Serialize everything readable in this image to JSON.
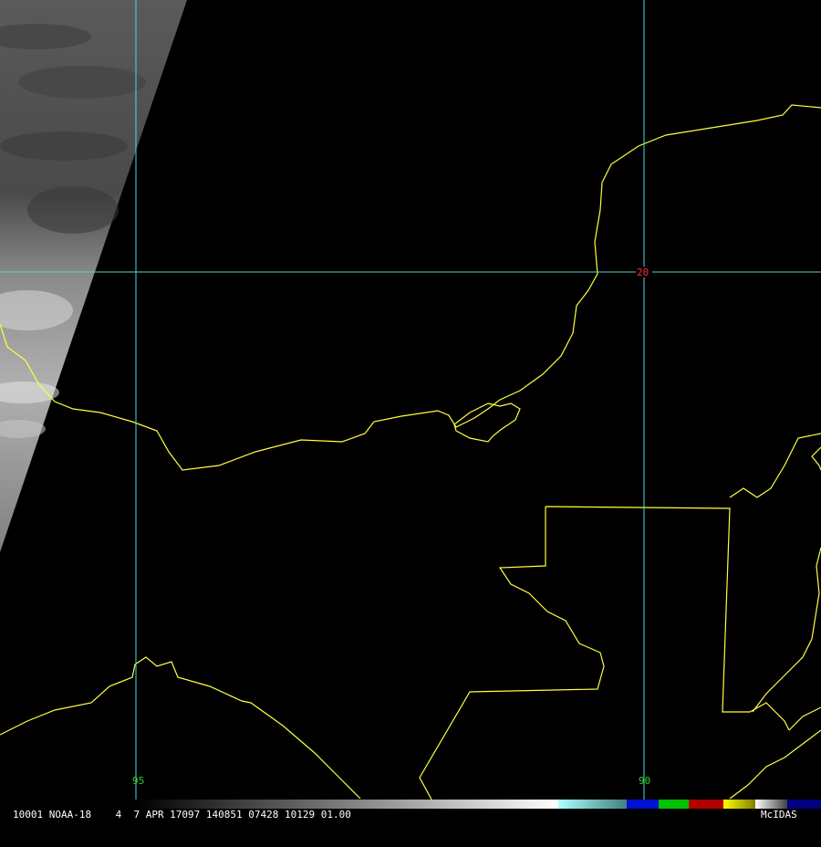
{
  "map": {
    "grid_labels": {
      "lat_20": "20",
      "lon_95": "95",
      "lon_90": "90"
    },
    "colors": {
      "grid": "#4fd6d6",
      "coast": "#ffff40",
      "lat_label": "#ff3030",
      "lon_label": "#30d030"
    }
  },
  "status_bar": {
    "info": "10001 NOAA-18    4  7 APR 17097 140851 07428 10129 01.00",
    "brand": "McIDAS"
  },
  "colorbar": {
    "gradient_colors": [
      "#000000",
      "#ffffff"
    ],
    "segments": [
      "#7fe0e0",
      "#0010d0",
      "#00c000",
      "#c00000",
      "#ffff00",
      "#a0a0a0",
      "#ffffff",
      "#000080"
    ]
  }
}
